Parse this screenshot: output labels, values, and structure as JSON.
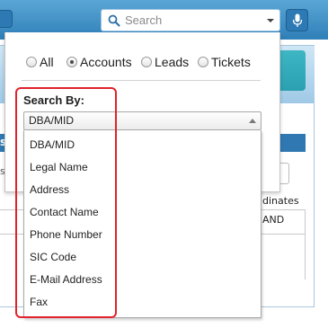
{
  "search": {
    "placeholder": "Search",
    "icon": "search-icon",
    "dropdown_icon": "caret-down-icon"
  },
  "scope_filters": [
    {
      "label": "All",
      "selected": false
    },
    {
      "label": "Accounts",
      "selected": true
    },
    {
      "label": "Leads",
      "selected": false
    },
    {
      "label": "Tickets",
      "selected": false
    }
  ],
  "search_by": {
    "label": "Search By:",
    "selected": "DBA/MID",
    "options": [
      "DBA/MID",
      "Legal Name",
      "Address",
      "Contact Name",
      "Phone Number",
      "SIC Code",
      "E-Mail Address",
      "Fax"
    ]
  },
  "background": {
    "partial_text_1": "dinates",
    "partial_text_2": "AND",
    "partial_glyph_1": "s",
    "partial_glyph_2": "s"
  },
  "colors": {
    "topbar": "#2f7fb8",
    "highlight": "#e0222b",
    "header_row": "#2f78b2"
  }
}
